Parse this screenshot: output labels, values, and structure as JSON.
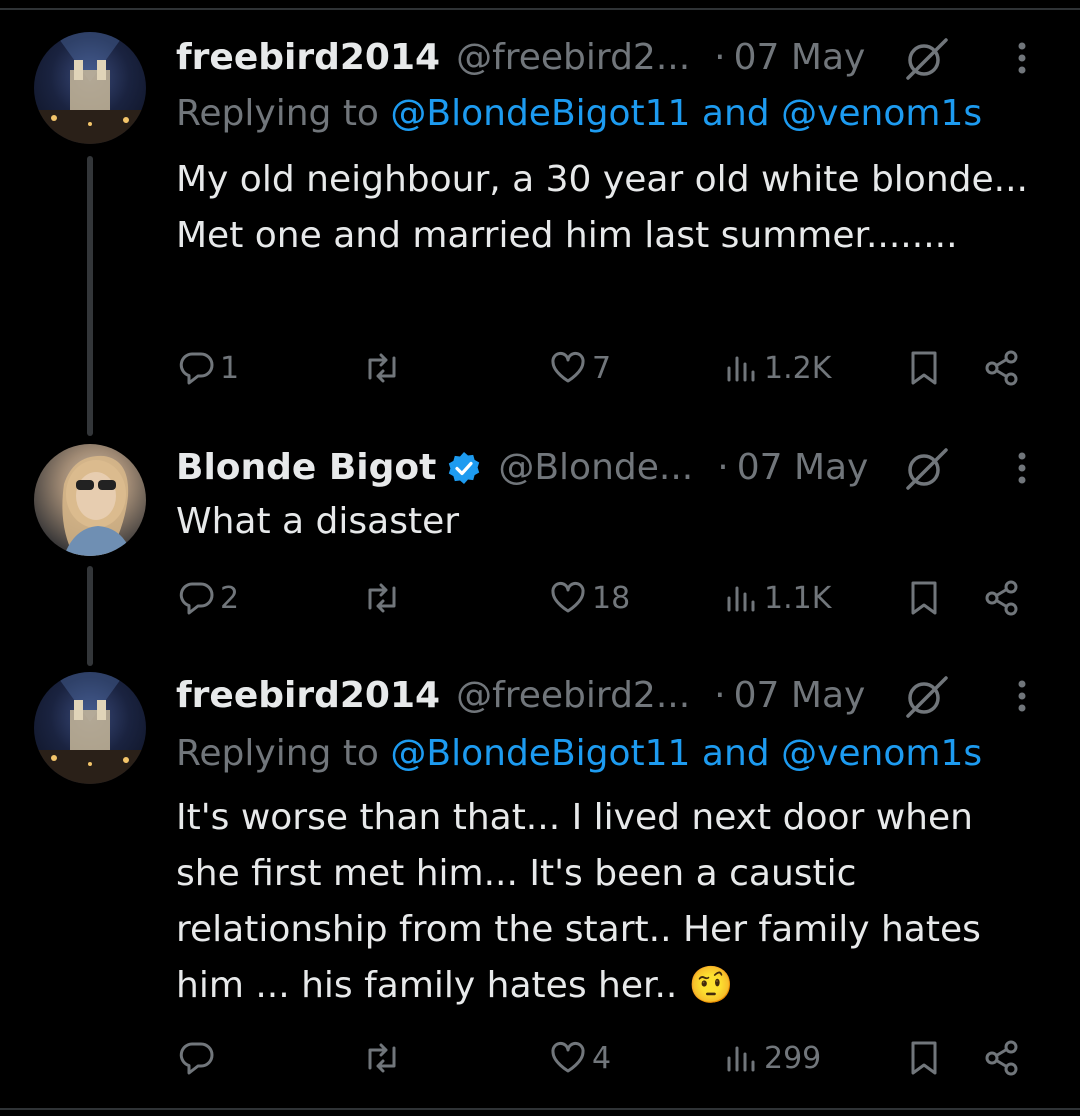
{
  "tweets": [
    {
      "name": "freebird2014",
      "handle": "@freebird2...",
      "dot": "·",
      "date": "07 May",
      "replying_prefix": "Replying to ",
      "replying_user1": "@BlondeBigot11",
      "replying_and": " and ",
      "replying_user2": "@venom1s",
      "text": "My old neighbour, a 30 year old white blonde... Met one and married him last summer........",
      "replies": "1",
      "reposts": "",
      "likes": "7",
      "views": "1.2K"
    },
    {
      "name": "Blonde Bigot",
      "handle": "@Blonde...",
      "dot": "·",
      "date": "07 May",
      "text": "What a disaster",
      "replies": "2",
      "reposts": "",
      "likes": "18",
      "views": "1.1K"
    },
    {
      "name": "freebird2014",
      "handle": "@freebird2...",
      "dot": "·",
      "date": "07 May",
      "replying_prefix": "Replying to ",
      "replying_user1": "@BlondeBigot11",
      "replying_and": " and ",
      "replying_user2": "@venom1s",
      "text": "It's worse than that... I lived next door when she first met him... It's been a caustic relationship from the start.. Her family hates him ... his family hates her.. 🤨",
      "replies": "",
      "reposts": "",
      "likes": "4",
      "views": "299"
    }
  ],
  "colors": {
    "background": "#000000",
    "text": "#e7e9ea",
    "muted": "#71767b",
    "link": "#1d9bf0",
    "verified": "#1d9bf0"
  },
  "icons": [
    "reply-icon",
    "repost-icon",
    "like-icon",
    "views-icon",
    "bookmark-icon",
    "share-icon",
    "grok-icon",
    "more-icon",
    "verified-badge-icon"
  ]
}
